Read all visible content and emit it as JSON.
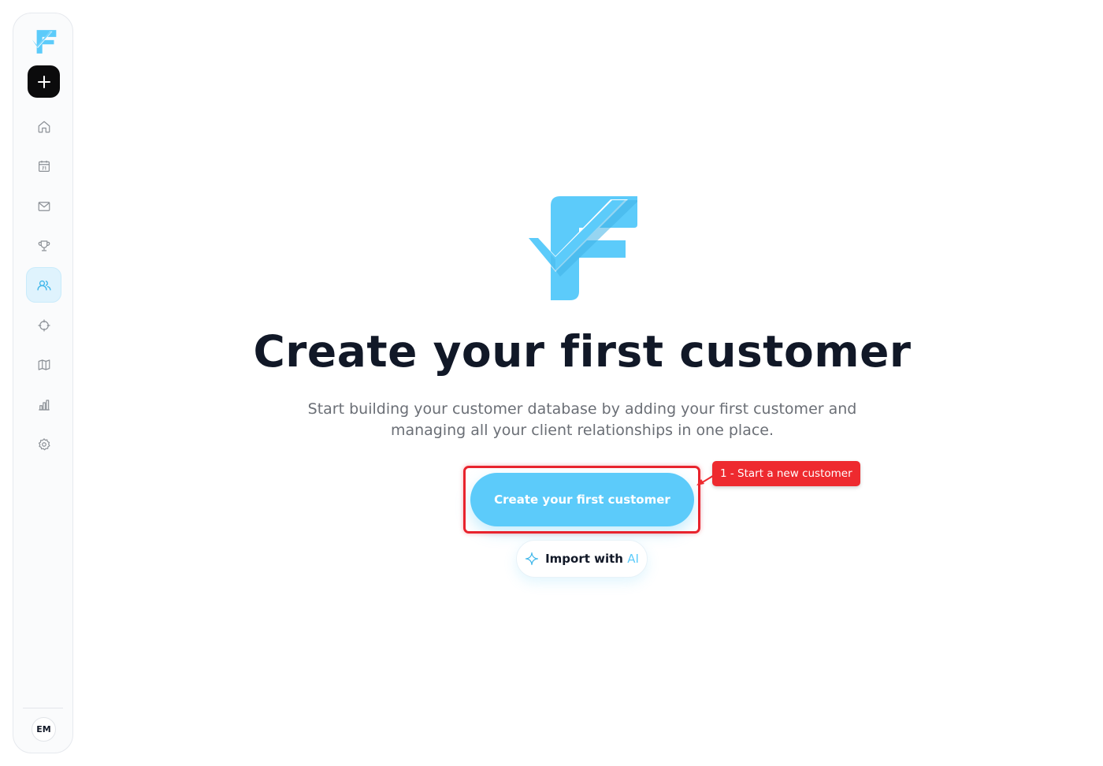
{
  "sidebar": {
    "logo_icon": "brand-logo-icon",
    "add_button_icon": "plus-icon",
    "items": [
      {
        "icon": "home-icon",
        "label": "Home",
        "active": false
      },
      {
        "icon": "calendar-icon",
        "label": "Calendar",
        "active": false
      },
      {
        "icon": "mail-icon",
        "label": "Mail",
        "active": false
      },
      {
        "icon": "trophy-icon",
        "label": "Trophy",
        "active": false
      },
      {
        "icon": "users-icon",
        "label": "Customers",
        "active": true
      },
      {
        "icon": "crosshair-icon",
        "label": "Target",
        "active": false
      },
      {
        "icon": "map-icon",
        "label": "Map",
        "active": false
      },
      {
        "icon": "bar-chart-icon",
        "label": "Reports",
        "active": false
      },
      {
        "icon": "gear-icon",
        "label": "Settings",
        "active": false
      }
    ],
    "avatar_initials": "EM"
  },
  "empty_state": {
    "title": "Create your first customer",
    "subtitle": "Start building your customer database by adding your first customer and managing all your client relationships in one place.",
    "primary_button_label": "Create your first customer",
    "secondary_button_label_prefix": "Import with ",
    "secondary_button_label_ai": "AI",
    "secondary_button_icon": "sparkle-icon"
  },
  "annotation": {
    "callout_text": "1 - Start a new customer"
  },
  "colors": {
    "accent": "#5ccbfa",
    "annotation_red": "#ee2a2f",
    "title_text": "#111827",
    "subtitle_text": "#6b6f76"
  }
}
